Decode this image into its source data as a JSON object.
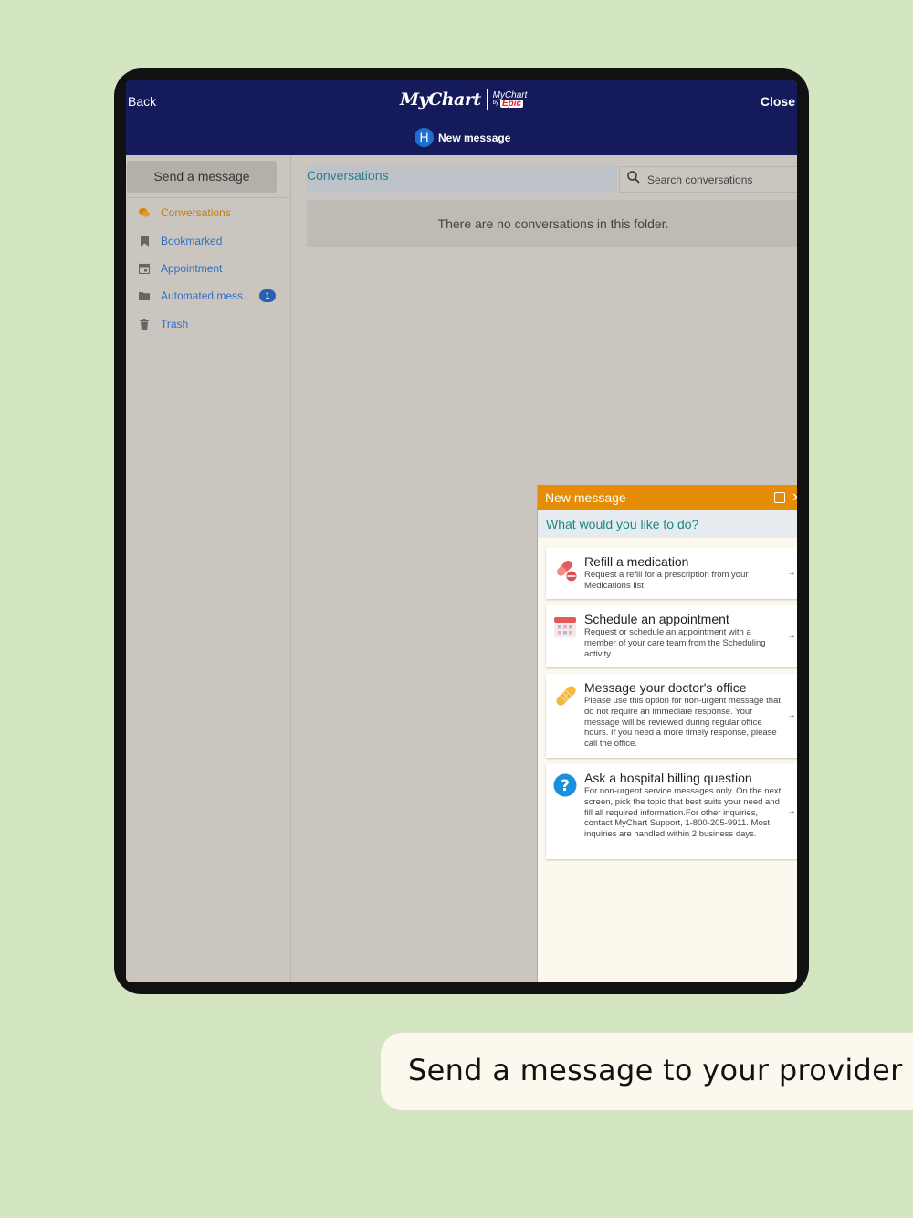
{
  "header": {
    "back_label": "Back",
    "close_label": "Close",
    "logo_main": "MyChart",
    "logo_small": "MyChart",
    "logo_by": "by",
    "logo_epic": "Epic",
    "avatar_letter": "H",
    "subtitle": "New message"
  },
  "sidebar": {
    "send_button": "Send a message",
    "items": [
      {
        "label": "Conversations",
        "icon": "chat-bubbles-icon"
      },
      {
        "label": "Bookmarked",
        "icon": "bookmark-icon"
      },
      {
        "label": "Appointment",
        "icon": "calendar-icon"
      },
      {
        "label": "Automated mess...",
        "icon": "folder-icon",
        "badge": "1"
      },
      {
        "label": "Trash",
        "icon": "trash-icon"
      }
    ]
  },
  "main": {
    "title": "Conversations",
    "search_placeholder": "Search conversations",
    "empty_text": "There are no conversations in this folder."
  },
  "panel": {
    "title": "New message",
    "question": "What would you like to do?",
    "options": [
      {
        "title": "Refill a medication",
        "desc": "Request a refill for a prescription from your Medications list.",
        "icon": "pill-icon"
      },
      {
        "title": "Schedule an appointment",
        "desc": "Request or schedule an appointment with a member of your care team from the Scheduling activity.",
        "icon": "calendar-icon"
      },
      {
        "title": "Message your doctor's office",
        "desc": "Please use this option for non-urgent message that do not require an immediate response. Your message will be reviewed during regular office hours. If you need a more timely response, please call the office.",
        "icon": "bandage-icon"
      },
      {
        "title": "Ask a hospital billing question",
        "desc": "For non-urgent service messages only. On the next screen, pick the topic that best suits your need and fill all required information.For other inquiries, contact MyChart Support, 1-800-205-9911. Most inquiries are handled within 2 business days.",
        "icon": "question-icon"
      }
    ]
  },
  "caption": "Send a message to your provider",
  "colors": {
    "topbar": "#151b5a",
    "accent_orange": "#e58d07",
    "link_blue": "#2f6fc0",
    "teal": "#1b8a7a",
    "background": "#d4e5c2"
  }
}
